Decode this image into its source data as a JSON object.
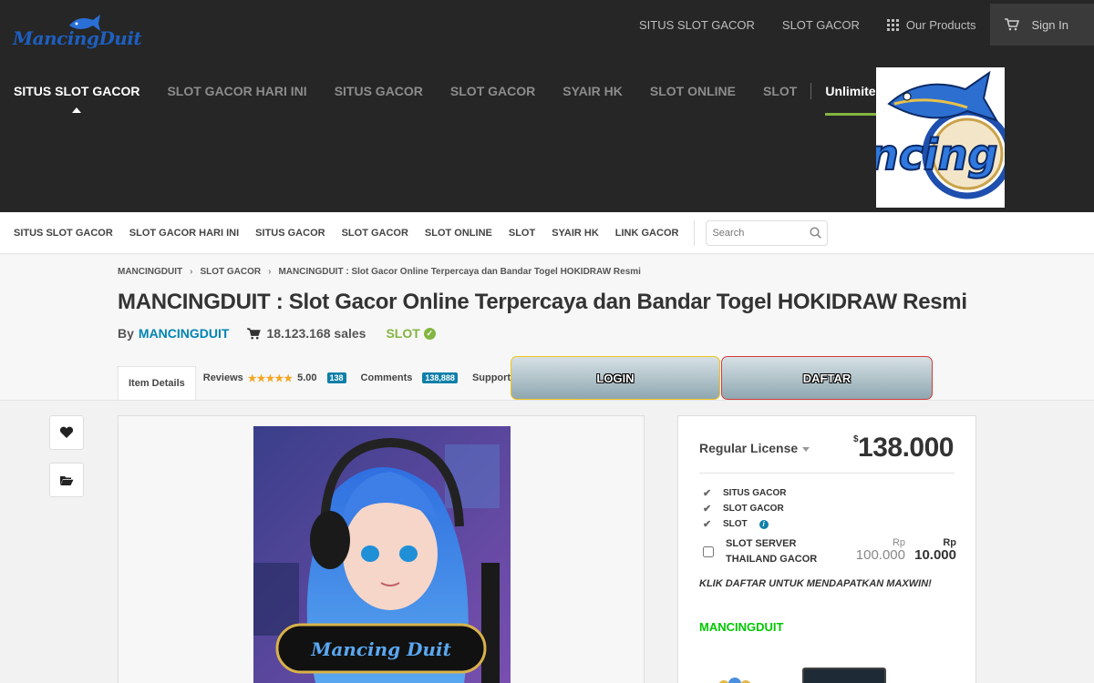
{
  "header": {
    "logo_text": "MancingDuit",
    "top_links": [
      "SITUS SLOT GACOR",
      "SLOT GACOR"
    ],
    "our_products": "Our Products",
    "sign_in": "Sign In"
  },
  "main_nav": {
    "items": [
      "SITUS SLOT GACOR",
      "SLOT GACOR HARI INI",
      "SITUS GACOR",
      "SLOT GACOR",
      "SYAIR HK",
      "SLOT ONLINE",
      "SLOT"
    ],
    "unlimited": "Unlimited Downloads"
  },
  "hero_image_text": "ncing",
  "sub_nav": {
    "items": [
      "SITUS SLOT GACOR",
      "SLOT GACOR HARI INI",
      "SITUS GACOR",
      "SLOT GACOR",
      "SLOT ONLINE",
      "SLOT",
      "SYAIR HK",
      "LINK GACOR"
    ],
    "search_placeholder": "Search"
  },
  "breadcrumb": [
    "MANCINGDUIT",
    "SLOT GACOR",
    "MANCINGDUIT : Slot Gacor Online Terpercaya dan Bandar Togel HOKIDRAW Resmi"
  ],
  "item": {
    "title": "MANCINGDUIT : Slot Gacor Online Terpercaya dan Bandar Togel HOKIDRAW Resmi",
    "by": "By",
    "author": "MANCINGDUIT",
    "sales": "18.123.168 sales",
    "category": "SLOT"
  },
  "tabs": {
    "item_details": "Item Details",
    "reviews": "Reviews",
    "rating": "5.00",
    "reviews_count": "138",
    "comments": "Comments",
    "comments_count": "138,888",
    "support": "Support"
  },
  "buttons": {
    "login": "LOGIN",
    "daftar": "DAFTAR"
  },
  "preview": {
    "logo_text": "Mancing Duit"
  },
  "license": {
    "title": "Regular License",
    "currency": "$",
    "price": "138.000",
    "features": [
      "SITUS GACOR",
      "SLOT GACOR",
      "SLOT"
    ],
    "addon_label": "SLOT SERVER THAILAND GACOR",
    "addon_old_currency": "Rp",
    "addon_old_price": "100.000",
    "addon_new_currency": "Rp",
    "addon_new_price": "10.000",
    "promo": "KLIK DAFTAR UNTUK MENDAPATKAN MAXWIN!",
    "brand": "MANCINGDUIT"
  },
  "colors": {
    "header_bg": "#262626",
    "accent_green": "#82b541",
    "link_blue": "#0084b4",
    "badge_blue": "#0f7fa8",
    "brand_green": "#00c800"
  }
}
